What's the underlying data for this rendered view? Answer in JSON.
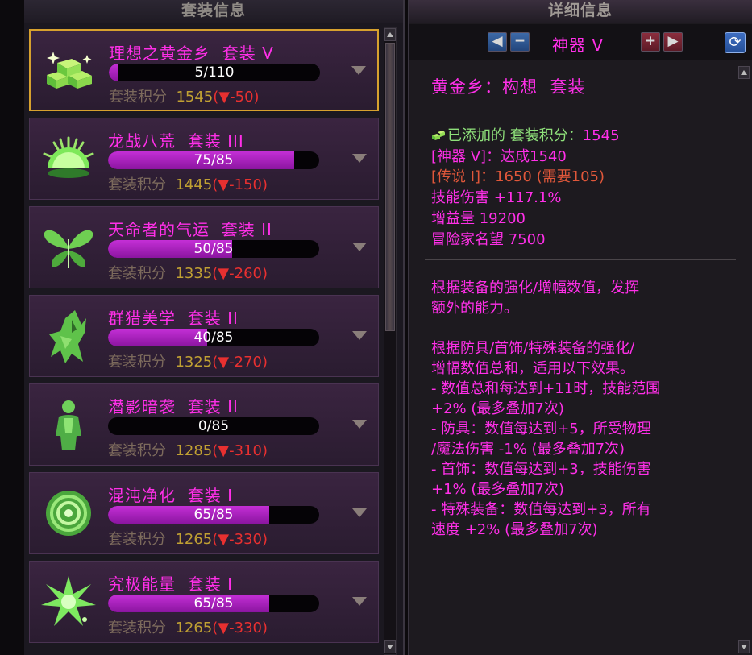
{
  "left_panel": {
    "title": "套装信息",
    "sets": [
      {
        "name": "理想之黄金乡  套装 V",
        "progress_text": "5/110",
        "progress": 0.045,
        "score_label": "套装积分",
        "score": "1545",
        "delta": "(▼-50)",
        "icon": "gold-bars-icon",
        "selected": true
      },
      {
        "name": "龙战八荒  套装 III",
        "progress_text": "75/85",
        "progress": 0.882,
        "score_label": "套装积分",
        "score": "1445",
        "delta": "(▼-150)",
        "icon": "rising-sun-icon",
        "selected": false
      },
      {
        "name": "天命者的气运  套装 II",
        "progress_text": "50/85",
        "progress": 0.588,
        "score_label": "套装积分",
        "score": "1335",
        "delta": "(▼-260)",
        "icon": "butterfly-leaf-icon",
        "selected": false
      },
      {
        "name": "群猎美学  套装 II",
        "progress_text": "40/85",
        "progress": 0.47,
        "score_label": "套装积分",
        "score": "1325",
        "delta": "(▼-270)",
        "icon": "wolf-icon",
        "selected": false
      },
      {
        "name": "潜影暗袭  套装 II",
        "progress_text": "0/85",
        "progress": 0.0,
        "score_label": "套装积分",
        "score": "1285",
        "delta": "(▼-310)",
        "icon": "silhouette-icon",
        "selected": false
      },
      {
        "name": "混沌净化  套装 I",
        "progress_text": "65/85",
        "progress": 0.765,
        "score_label": "套装积分",
        "score": "1265",
        "delta": "(▼-330)",
        "icon": "rose-icon",
        "selected": false
      },
      {
        "name": "究极能量  套装 I",
        "progress_text": "65/85",
        "progress": 0.765,
        "score_label": "套装积分",
        "score": "1265",
        "delta": "(▼-330)",
        "icon": "energy-burst-icon",
        "selected": false
      }
    ]
  },
  "right_panel": {
    "title": "详细信息",
    "grade": "神器 V",
    "full_name": "黄金乡：构想  套装",
    "added_label": "已添加的 套装积分：",
    "added_value": "1545",
    "stat_artifact": "[神器 V]：达成1540",
    "stat_legend": "[传说 I]：1650 (需要105)",
    "skill_damage_label": "技能伤害",
    "skill_damage_value": "+117.1%",
    "buff_label": "增益量",
    "buff_value": "19200",
    "fame_label": "冒险家名望",
    "fame_value": "7500",
    "desc1": [
      "根据装备的强化/增幅数值，发挥",
      "额外的能力。"
    ],
    "desc2": [
      "根据防具/首饰/特殊装备的强化/",
      "增幅数值总和，适用以下效果。",
      "- 数值总和每达到+11时，技能范围",
      "+2% (最多叠加7次)",
      "- 防具：数值每达到+5，所受物理",
      "/魔法伤害 -1% (最多叠加7次)",
      "- 首饰：数值每达到+3，技能伤害",
      "+1% (最多叠加7次)",
      "- 特殊装备：数值每达到+3，所有",
      "速度 +2% (最多叠加7次)"
    ]
  },
  "colors": {
    "name": "#ff2fe8",
    "score": "#c0a033",
    "delta": "#e83030",
    "selected_border": "#d7a12e"
  }
}
